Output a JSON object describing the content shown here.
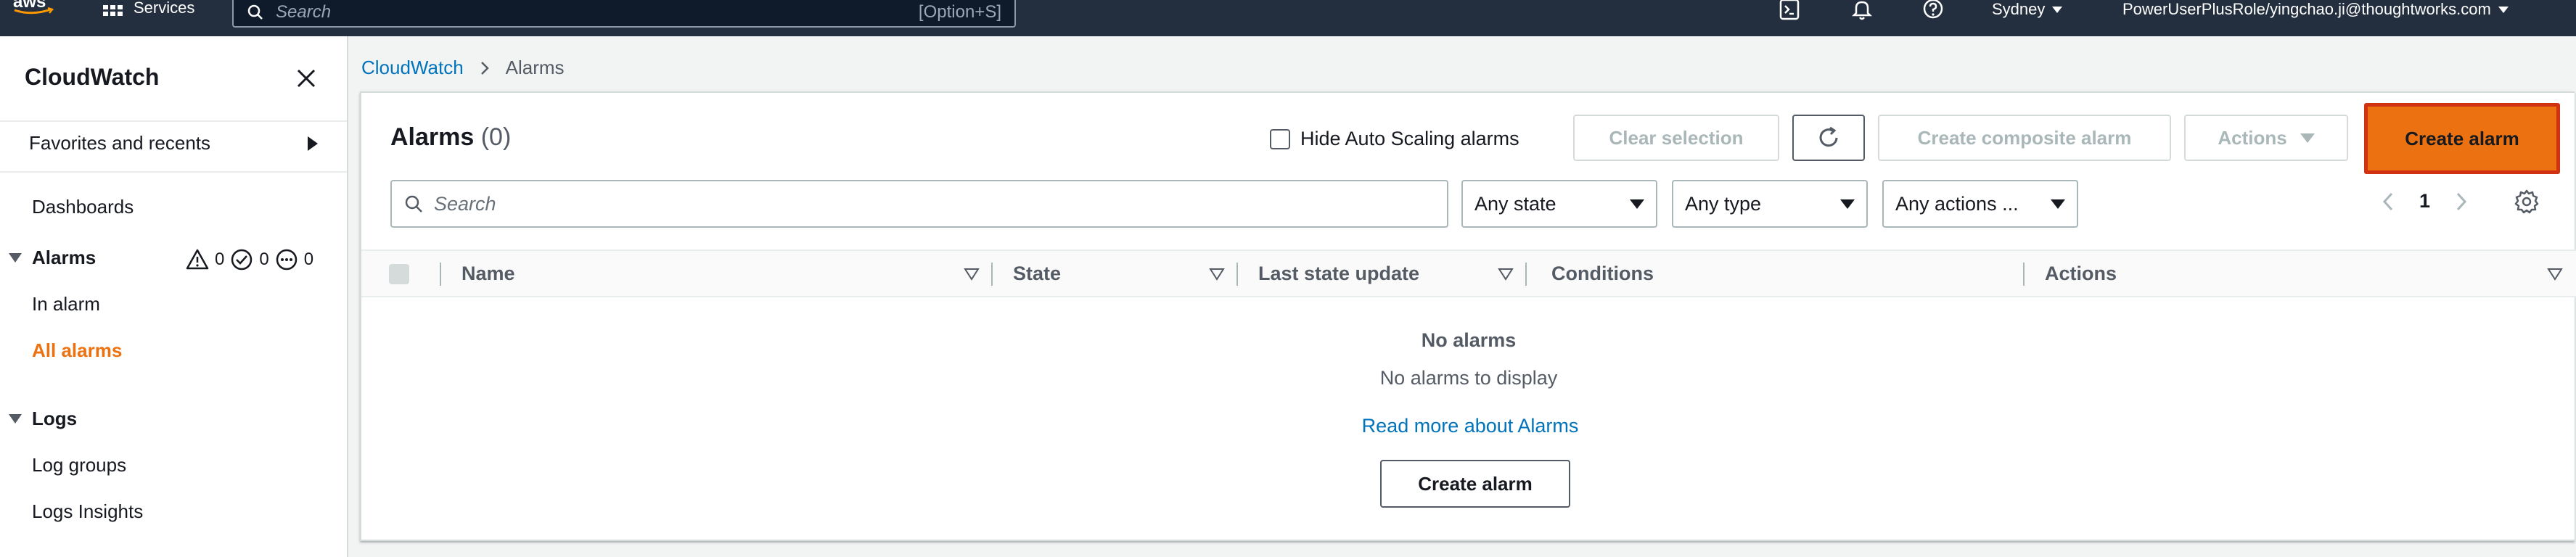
{
  "topnav": {
    "logo_text": "aws",
    "services_label": "Services",
    "search_placeholder": "Search",
    "search_shortcut": "[Option+S]",
    "region": "Sydney",
    "account": "PowerUserPlusRole/yingchao.ji@thoughtworks.com"
  },
  "sidebar": {
    "title": "CloudWatch",
    "favorites": "Favorites and recents",
    "dashboards": "Dashboards",
    "alarms_section": "Alarms",
    "alarm_counts": {
      "in_alarm": "0",
      "ok": "0",
      "insufficient": "0"
    },
    "in_alarm": "In alarm",
    "all_alarms": "All alarms",
    "logs_section": "Logs",
    "log_groups": "Log groups",
    "logs_insights": "Logs Insights"
  },
  "breadcrumb": {
    "root": "CloudWatch",
    "current": "Alarms"
  },
  "alarms": {
    "title": "Alarms",
    "count": "(0)",
    "hide_autoscaling": "Hide Auto Scaling alarms",
    "clear_selection": "Clear selection",
    "create_composite": "Create composite alarm",
    "actions": "Actions",
    "create_alarm": "Create alarm",
    "search_placeholder": "Search",
    "filter_state": "Any state",
    "filter_type": "Any type",
    "filter_actions": "Any actions ...",
    "page": "1",
    "columns": [
      "Name",
      "State",
      "Last state update",
      "Conditions",
      "Actions"
    ],
    "empty_title": "No alarms",
    "empty_sub": "No alarms to display",
    "read_more": "Read more about Alarms",
    "empty_create": "Create alarm"
  },
  "colors": {
    "accent": "#ec7211",
    "link": "#0073bb",
    "nav_bg": "#232f3e",
    "highlight": "#d13212"
  }
}
